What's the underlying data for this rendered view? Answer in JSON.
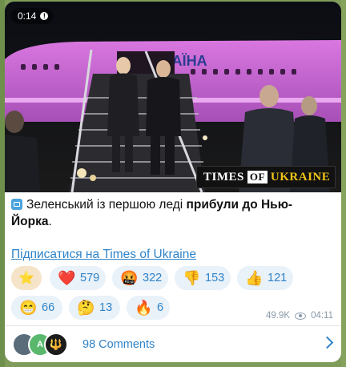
{
  "video": {
    "timer": "0:14",
    "plane_livery": "УКРАЇНА",
    "watermark": {
      "part1": "TIMES",
      "part2": "OF",
      "part3": "UKRAINE"
    }
  },
  "post": {
    "caption_plain": "Зеленський із першою леді ",
    "caption_bold": "прибули до Нью-Йорка",
    "caption_end": ".",
    "link_text": "Підписатися на Times of Ukraine"
  },
  "reactions": [
    {
      "emoji": "⭐",
      "count": ""
    },
    {
      "emoji": "❤️",
      "count": "579"
    },
    {
      "emoji": "🤬",
      "count": "322"
    },
    {
      "emoji": "👎",
      "count": "153"
    },
    {
      "emoji": "👍",
      "count": "121"
    },
    {
      "emoji": "😁",
      "count": "66"
    },
    {
      "emoji": "🤔",
      "count": "13"
    },
    {
      "emoji": "🔥",
      "count": "6"
    }
  ],
  "meta": {
    "views": "49.9K",
    "time": "04:11"
  },
  "comments": {
    "label": "98 Comments",
    "avatars": [
      "",
      "A",
      "🔱"
    ]
  },
  "colors": {
    "accent": "#2e83c8",
    "chip_bg": "#e9f1f9",
    "star_chip_bg": "#f5e4c9",
    "background": "#7f9c5a"
  }
}
